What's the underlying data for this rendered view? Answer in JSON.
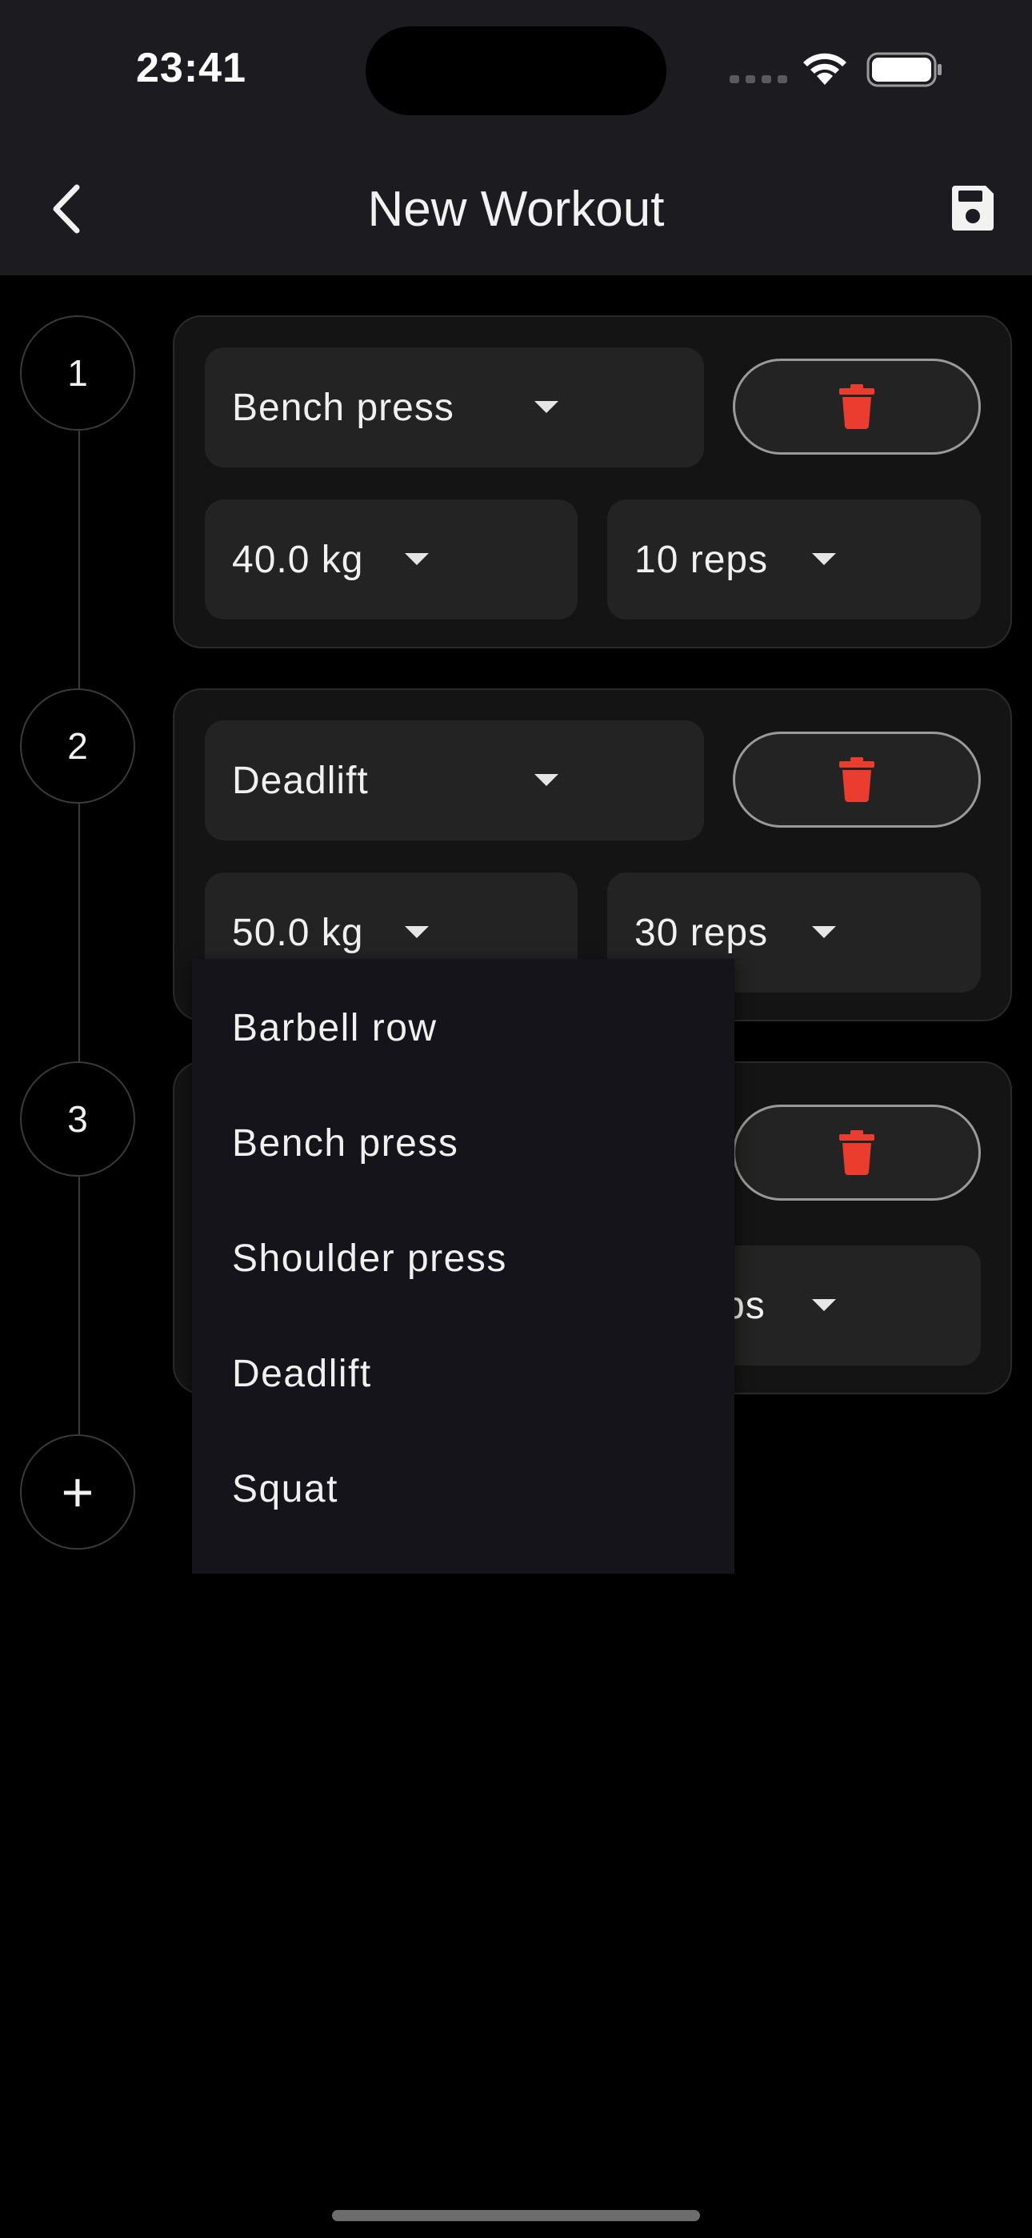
{
  "status_bar": {
    "time": "23:41"
  },
  "app_bar": {
    "title": "New Workout",
    "back_icon": "chevron-left-icon",
    "save_icon": "floppy-disk-icon"
  },
  "colors": {
    "delete_icon": "#ea3c2f",
    "app_bar_bg": "#1c1b20",
    "card_bg": "#141414",
    "field_bg": "#232323",
    "menu_bg": "#15141b"
  },
  "exercises": [
    {
      "step": "1",
      "exercise": "Bench press",
      "weight": "40.0 kg",
      "reps": "10 reps"
    },
    {
      "step": "2",
      "exercise": "Deadlift",
      "weight": "50.0 kg",
      "reps": "30 reps"
    },
    {
      "step": "3",
      "exercise": "",
      "weight": "",
      "reps": "ps"
    }
  ],
  "add_step": "+",
  "exercise_menu": {
    "options": [
      "Barbell row",
      "Bench press",
      "Shoulder press",
      "Deadlift",
      "Squat"
    ]
  }
}
